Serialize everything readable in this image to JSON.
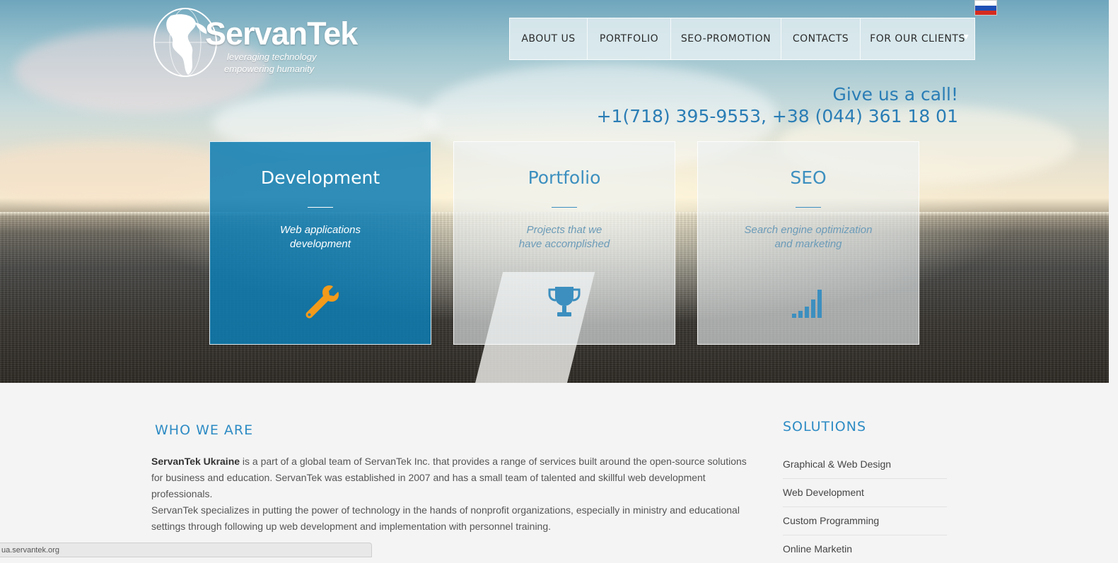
{
  "logo": {
    "brand": "ServanTek",
    "tagline_1": "leveraging technology",
    "tagline_2": "empowering humanity"
  },
  "language_flag": {
    "icon": "russian-flag-icon",
    "colors": [
      "#ffffff",
      "#1f4fb5",
      "#d52b1e"
    ]
  },
  "nav": {
    "items": [
      {
        "label": "ABOUT US"
      },
      {
        "label": "PORTFOLIO"
      },
      {
        "label": "SEO-PROMOTION"
      },
      {
        "label": "CONTACTS"
      },
      {
        "label": "FOR OUR CLIENTS",
        "has_dropdown": true
      }
    ]
  },
  "call": {
    "heading": "Give us a call!",
    "phones": "+1(718) 395-9553, +38 (044) 361 18 01"
  },
  "services": [
    {
      "title": "Development",
      "desc_1": "Web applications",
      "desc_2": "development",
      "icon": "wrench-icon",
      "icon_color": "#f39a1a",
      "active": true
    },
    {
      "title": "Portfolio",
      "desc_1": "Projects that we",
      "desc_2": "have accomplished",
      "icon": "trophy-icon",
      "icon_color": "#3c8fbf",
      "active": false
    },
    {
      "title": "SEO",
      "desc_1": "Search engine optimization",
      "desc_2": "and marketing",
      "icon": "signal-bars-icon",
      "icon_color": "#3c8fbf",
      "active": false
    }
  ],
  "who": {
    "title": "WHO WE ARE",
    "company": "ServanTek Ukraine",
    "p1": " is a part of a global team of ServanTek Inc. that provides a range of services built around the open-source solutions for business and education. ServanTek was established in 2007 and has a small team of talented and skillful web development professionals.",
    "p2": "ServanTek specializes in putting the power of technology in the hands of nonprofit organizations, especially in ministry and educational settings through following up web development and implementation with personnel training."
  },
  "solutions": {
    "title": "SOLUTIONS",
    "items": [
      {
        "label": "Graphical & Web Design"
      },
      {
        "label": "Web Development"
      },
      {
        "label": "Custom Programming"
      },
      {
        "label": "Online Marketin"
      }
    ]
  },
  "status_bar": {
    "url": "ua.servantek.org"
  },
  "colors": {
    "accent": "#2d8bc4",
    "active_box": "#0e7db2",
    "wrench": "#f39a1a"
  }
}
